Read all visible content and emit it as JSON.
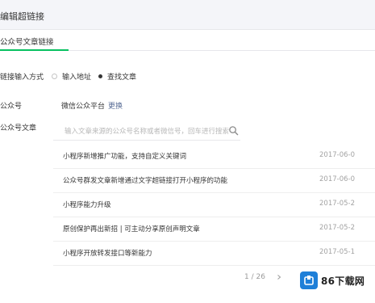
{
  "dialog": {
    "title": "编辑超链接"
  },
  "tabs": [
    {
      "label": "公众号文章链接"
    }
  ],
  "link_method": {
    "label": "链接输入方式",
    "options": [
      {
        "label": "输入地址",
        "selected": false
      },
      {
        "label": "查找文章",
        "selected": true
      }
    ]
  },
  "account": {
    "label": "公众号",
    "value": "微信公众平台",
    "link": "更换"
  },
  "article": {
    "label": "公众号文章",
    "search_placeholder": "输入文章来源的公众号名称或者微信号，回车进行搜索",
    "rows": [
      {
        "title": "小程序新增推广功能，支持自定义关键词",
        "date": "2017-06-0"
      },
      {
        "title": "公众号群发文章新增通过文字超链接打开小程序的功能",
        "date": "2017-06-0"
      },
      {
        "title": "小程序能力升级",
        "date": "2017-05-2"
      },
      {
        "title": "原创保护再出新招 | 可主动分享原创声明文章",
        "date": "2017-05-2"
      },
      {
        "title": "小程序开放转发接口等新能力",
        "date": "2017-05-1"
      }
    ]
  },
  "pager": {
    "text": "1 / 26"
  },
  "watermark": {
    "text": "86下载网"
  },
  "colors": {
    "accent": "#07c160",
    "link": "#576b95",
    "logo_blue": "#1e7fd8"
  },
  "icons": {
    "search": "search-icon",
    "next": "chevron-right-icon",
    "logo": "download-box-icon"
  }
}
